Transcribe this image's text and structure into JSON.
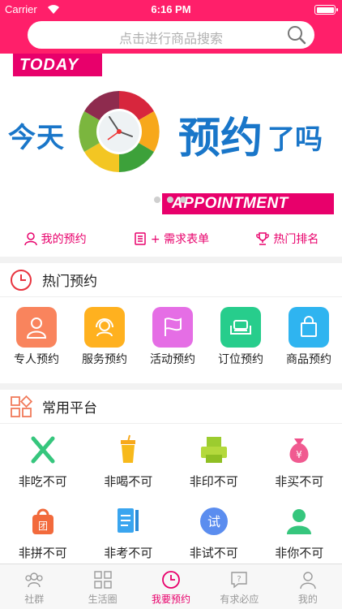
{
  "status": {
    "carrier": "Carrier",
    "time": "6:16 PM"
  },
  "search": {
    "placeholder": "点击进行商品搜索"
  },
  "banner": {
    "today": "TODAY",
    "text_left": "今天",
    "text_main": "预约",
    "text_tail": "了吗",
    "appointment": "APPOINTMENT"
  },
  "quick_links": [
    {
      "label": "我的预约",
      "icon": "person-icon"
    },
    {
      "label": "+ 需求表单",
      "icon": "form-icon"
    },
    {
      "label": "热门排名",
      "icon": "trophy-icon"
    }
  ],
  "hot": {
    "title": "热门预约",
    "items": [
      {
        "label": "专人预约",
        "color": "#f9845d",
        "icon": "person-icon"
      },
      {
        "label": "服务预约",
        "color": "#ffb11f",
        "icon": "headset-icon"
      },
      {
        "label": "活动预约",
        "color": "#e56ee5",
        "icon": "flag-icon"
      },
      {
        "label": "订位预约",
        "color": "#27cd8c",
        "icon": "sofa-icon"
      },
      {
        "label": "商品预约",
        "color": "#2fb4f0",
        "icon": "shopping-bag-icon"
      }
    ]
  },
  "platform": {
    "title": "常用平台",
    "items": [
      {
        "label": "非吃不可",
        "icon": "fork-knife-icon"
      },
      {
        "label": "非喝不可",
        "icon": "drink-icon"
      },
      {
        "label": "非印不可",
        "icon": "printer-icon"
      },
      {
        "label": "非买不可",
        "icon": "money-bag-icon"
      },
      {
        "label": "非拼不可",
        "icon": "group-buy-icon"
      },
      {
        "label": "非考不可",
        "icon": "exam-icon"
      },
      {
        "label": "非试不可",
        "icon": "trial-icon"
      },
      {
        "label": "非你不可",
        "icon": "user-icon"
      }
    ]
  },
  "tabs": [
    {
      "label": "社群",
      "icon": "community-icon",
      "active": false
    },
    {
      "label": "生活圈",
      "icon": "grid-icon",
      "active": false
    },
    {
      "label": "我要预约",
      "icon": "clock-icon",
      "active": true
    },
    {
      "label": "有求必应",
      "icon": "question-icon",
      "active": false
    },
    {
      "label": "我的",
      "icon": "profile-icon",
      "active": false
    }
  ],
  "colors": {
    "brand": "#ff1f6a",
    "accent": "#e8006b",
    "banner_text": "#1976c9"
  }
}
